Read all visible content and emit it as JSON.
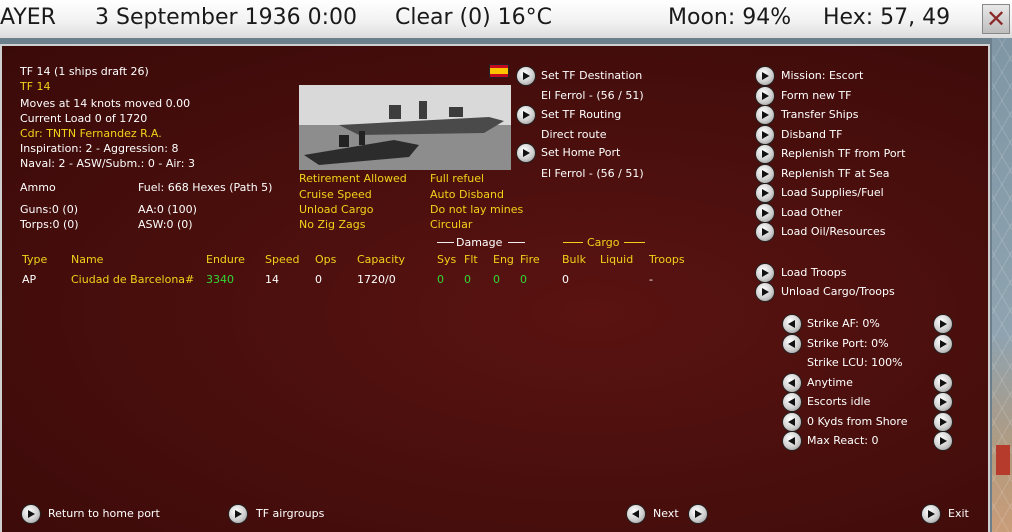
{
  "top_bar": {
    "side_fragment": "AYER",
    "date_time": "3 September 1936 0:00",
    "weather": "Clear (0) 16°C",
    "moon": "Moon: 94%",
    "hex": "Hex: 57, 49",
    "close_glyph": "✕"
  },
  "tf_info": {
    "header": "TF 14 (1 ships draft 26)",
    "name": "TF 14",
    "moves": "Moves at 14 knots moved 0.00",
    "load": "Current Load 0 of 1720",
    "commander": "Cdr: TNTN Fernandez R.A.",
    "inspiration": "Inspiration: 2 - Aggression: 8",
    "skills": "Naval: 2 - ASW/Subm.: 0 - Air: 3",
    "ammo_label": "Ammo",
    "fuel": "Fuel: 668 Hexes (Path 5)",
    "guns": "Guns:0 (0)",
    "aa": "AA:0 (100)",
    "torps": "Torps:0 (0)",
    "asw": "ASW:0 (0)"
  },
  "options_left": [
    "Retirement Allowed",
    "Cruise Speed",
    "Unload Cargo",
    "No Zig Zags"
  ],
  "options_right": [
    "Full refuel",
    "Auto Disband",
    "Do not lay mines",
    "Circular"
  ],
  "commands_mid": {
    "set_destination": "Set TF Destination",
    "destination_value": "El Ferrol - (56 / 51)",
    "set_routing": "Set TF Routing",
    "routing_value": "Direct route",
    "set_home": "Set Home Port",
    "home_value": "El Ferrol - (56 / 51)"
  },
  "commands_right": [
    "Mission: Escort",
    "Form new TF",
    "Transfer Ships",
    "Disband TF",
    "Replenish TF from Port",
    "Replenish TF at Sea",
    "Load Supplies/Fuel",
    "Load Other",
    "Load Oil/Resources"
  ],
  "commands_troops": [
    "Load Troops",
    "Unload Cargo/Troops"
  ],
  "strike_settings": [
    "Strike AF: 0%",
    "Strike Port: 0%",
    "Strike LCU: 100%",
    "Anytime",
    "Escorts idle",
    "0 Kyds from Shore",
    "Max React: 0"
  ],
  "table": {
    "group_damage": "Damage",
    "group_cargo": "Cargo",
    "headers": {
      "type": "Type",
      "name": "Name",
      "endure": "Endure",
      "speed": "Speed",
      "ops": "Ops",
      "capacity": "Capacity",
      "sys": "Sys",
      "flt": "Flt",
      "eng": "Eng",
      "fire": "Fire",
      "bulk": "Bulk",
      "liquid": "Liquid",
      "troops": "Troops"
    },
    "row": {
      "type": "AP",
      "name": "Ciudad de Barcelona#",
      "endure": "3340",
      "speed": "14",
      "ops": "0",
      "capacity": "1720/0",
      "sys": "0",
      "flt": "0",
      "eng": "0",
      "fire": "0",
      "bulk": "0",
      "liquid": "",
      "troops": "-"
    }
  },
  "bottom": {
    "return_home": "Return to home port",
    "airgroups": "TF airgroups",
    "next": "Next",
    "exit": "Exit"
  },
  "icons": {
    "arrow_right": "arrow-right-icon",
    "arrow_left": "arrow-left-icon",
    "flag": "spain-flag-icon"
  }
}
